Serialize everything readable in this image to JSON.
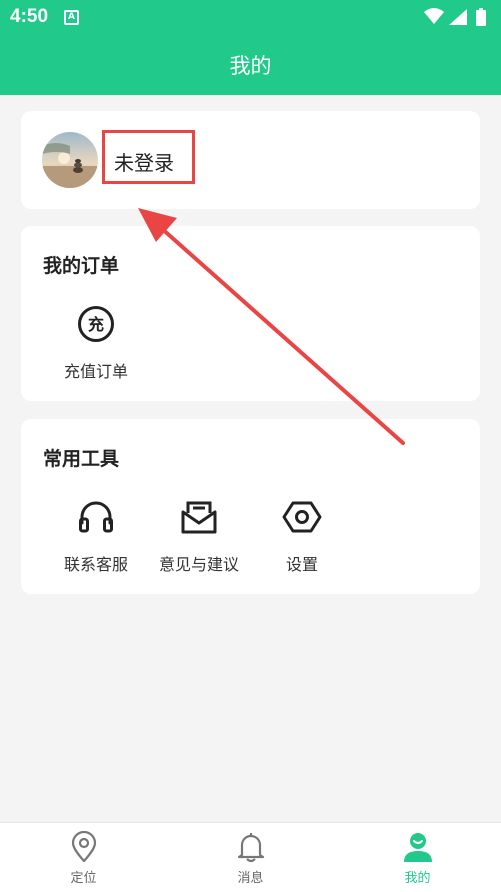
{
  "status_bar": {
    "time": "4:50",
    "badge": "A"
  },
  "header": {
    "title": "我的"
  },
  "profile": {
    "login_label": "未登录"
  },
  "orders": {
    "title": "我的订单",
    "items": [
      {
        "label": "充值订单",
        "icon": "charge-icon",
        "glyph": "充"
      }
    ]
  },
  "tools": {
    "title": "常用工具",
    "items": [
      {
        "label": "联系客服",
        "icon": "headset-icon"
      },
      {
        "label": "意见与建议",
        "icon": "mail-feedback-icon"
      },
      {
        "label": "设置",
        "icon": "settings-hexagon-icon"
      }
    ]
  },
  "tabbar": {
    "items": [
      {
        "label": "定位",
        "icon": "location-pin-icon",
        "active": false
      },
      {
        "label": "消息",
        "icon": "bell-icon",
        "active": false
      },
      {
        "label": "我的",
        "icon": "user-icon",
        "active": true
      }
    ]
  },
  "colors": {
    "accent": "#21c98a",
    "annotation": "#e94545",
    "background": "#f4f4f4"
  }
}
